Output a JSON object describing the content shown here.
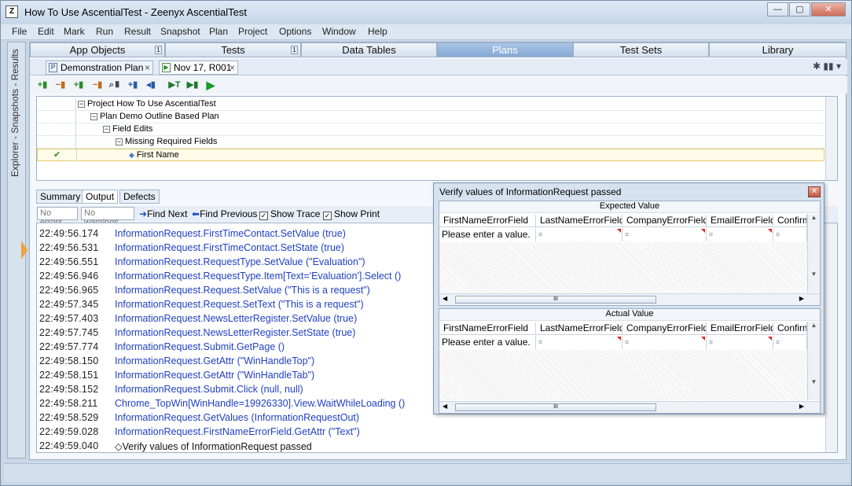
{
  "window": {
    "title": "How To Use AscentialTest - Zeenyx AscentialTest",
    "icon": "Z",
    "minimize": "—",
    "maximize": "▢",
    "close": "✕"
  },
  "menu": [
    "File",
    "Edit",
    "Mark",
    "Run",
    "Result",
    "Snapshot",
    "Plan",
    "Project",
    "Options",
    "Window",
    "Help"
  ],
  "sidebar": {
    "label": "Explorer - Snapshots - Results"
  },
  "tabs": [
    {
      "label": "App Objects",
      "badge": "1"
    },
    {
      "label": "Tests",
      "badge": "1"
    },
    {
      "label": "Data Tables"
    },
    {
      "label": "Plans"
    },
    {
      "label": "Test Sets"
    },
    {
      "label": "Library"
    }
  ],
  "subtabs": [
    {
      "icon": "P",
      "label": "Demonstration Plan",
      "close": "×"
    },
    {
      "icon": "▶",
      "label": "Nov 17, R001",
      "close": "×"
    }
  ],
  "toolbar_icons": [
    "+▮",
    "−▮",
    "+▮",
    "−▮",
    "⌕▮",
    "+▮",
    "◂▮",
    "▶T",
    "▶▮",
    "▶"
  ],
  "tree": [
    {
      "label": "Project How To Use AscentialTest",
      "exp": "−"
    },
    {
      "label": "Plan Demo Outline Based Plan",
      "exp": "−"
    },
    {
      "label": "Field Edits",
      "exp": "−"
    },
    {
      "label": "Missing Required Fields",
      "exp": "−"
    },
    {
      "label": "First Name",
      "exp": "◆",
      "check": "✔"
    }
  ],
  "bottom_tabs": [
    "Summary",
    "Output",
    "Defects"
  ],
  "filter": {
    "errors": "No errors",
    "warnings": "No warnings",
    "find_next": "Find Next",
    "find_prev": "Find Previous",
    "show_trace": "Show Trace",
    "show_print": "Show Print",
    "check": "✓"
  },
  "log": [
    {
      "t": "22:49:56.174",
      "m": "InformationRequest.FirstTimeContact.SetValue (true)"
    },
    {
      "t": "22:49:56.531",
      "m": "InformationRequest.FirstTimeContact.SetState (true)"
    },
    {
      "t": "22:49:56.551",
      "m": "InformationRequest.RequestType.SetValue (\"Evaluation\")"
    },
    {
      "t": "22:49:56.946",
      "m": "InformationRequest.RequestType.Item[Text='Evaluation'].Select ()"
    },
    {
      "t": "22:49:56.965",
      "m": "InformationRequest.Request.SetValue (\"This is a request\")"
    },
    {
      "t": "22:49:57.345",
      "m": "InformationRequest.Request.SetText (\"This is a request\")"
    },
    {
      "t": "22:49:57.403",
      "m": "InformationRequest.NewsLetterRegister.SetValue (true)"
    },
    {
      "t": "22:49:57.745",
      "m": "InformationRequest.NewsLetterRegister.SetState (true)"
    },
    {
      "t": "22:49:57.774",
      "m": "InformationRequest.Submit.GetPage ()"
    },
    {
      "t": "22:49:58.150",
      "m": "InformationRequest.GetAttr (\"WinHandleTop\")"
    },
    {
      "t": "22:49:58.151",
      "m": "InformationRequest.GetAttr (\"WinHandleTab\")"
    },
    {
      "t": "22:49:58.152",
      "m": "InformationRequest.Submit.Click (null, null)"
    },
    {
      "t": "22:49:58.211",
      "m": "Chrome_TopWin[WinHandle=19926330].View.WaitWhileLoading ()"
    },
    {
      "t": "22:49:58.529",
      "m": "InformationRequest.GetValues (InformationRequestOut)"
    },
    {
      "t": "22:49:59.028",
      "m": "InformationRequest.FirstNameErrorField.GetAttr (\"Text\")"
    },
    {
      "t": "22:49:59.040",
      "m": "◇Verify values of InformationRequest passed"
    }
  ],
  "dialog": {
    "title": "Verify values of InformationRequest passed",
    "close": "✕",
    "expected_label": "Expected Value",
    "actual_label": "Actual Value",
    "columns": [
      "FirstNameErrorField",
      "LastNameErrorField",
      "CompanyErrorField",
      "EmailErrorField",
      "Confirm"
    ],
    "expected_row": [
      "Please enter a value.",
      "¤",
      "¤",
      "¤",
      "¤"
    ],
    "actual_row": [
      "Please enter a value.",
      "¤",
      "¤",
      "¤",
      "¤"
    ],
    "thumb": "III"
  }
}
